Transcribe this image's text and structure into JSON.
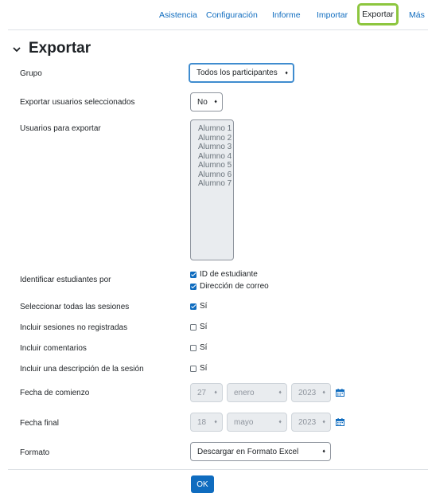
{
  "nav": {
    "tabs": [
      "Asistencia",
      "Configuración",
      "Informe",
      "Importar"
    ],
    "active": "Exportar",
    "more": "Más"
  },
  "page": {
    "title": "Exportar"
  },
  "form": {
    "grupo": {
      "label": "Grupo",
      "value": "Todos los participantes"
    },
    "exportar_seleccionados": {
      "label": "Exportar usuarios seleccionados",
      "value": "No"
    },
    "usuarios": {
      "label": "Usuarios para exportar",
      "options": [
        "Alumno 1",
        "Alumno 2",
        "Alumno 3",
        "Alumno 4",
        "Alumno 5",
        "Alumno 6",
        "Alumno 7"
      ]
    },
    "identificar": {
      "label": "Identificar estudiantes por",
      "options": [
        {
          "label": "ID de estudiante",
          "checked": true
        },
        {
          "label": "Dirección de correo",
          "checked": true
        }
      ]
    },
    "todas_sesiones": {
      "label": "Seleccionar todas las sesiones",
      "checkbox": "Sí",
      "checked": true
    },
    "no_registradas": {
      "label": "Incluir sesiones no registradas",
      "checkbox": "Sí",
      "checked": false
    },
    "comentarios": {
      "label": "Incluir comentarios",
      "checkbox": "Sí",
      "checked": false
    },
    "descripcion": {
      "label": "Incluir una descripción de la sesión",
      "checkbox": "Sí",
      "checked": false
    },
    "fecha_comienzo": {
      "label": "Fecha de comienzo",
      "day": "27",
      "month": "enero",
      "year": "2023"
    },
    "fecha_final": {
      "label": "Fecha final",
      "day": "18",
      "month": "mayo",
      "year": "2023"
    },
    "formato": {
      "label": "Formato",
      "value": "Descargar en Formato Excel"
    },
    "submit": "OK"
  },
  "icons": {
    "collapse": "chevron-down-icon",
    "calendar": "calendar-icon",
    "dropdown": "caret-updown-icon"
  },
  "colors": {
    "link": "#0f6cbf",
    "highlight": "#8dc63f",
    "focus": "#3f8ccf"
  }
}
